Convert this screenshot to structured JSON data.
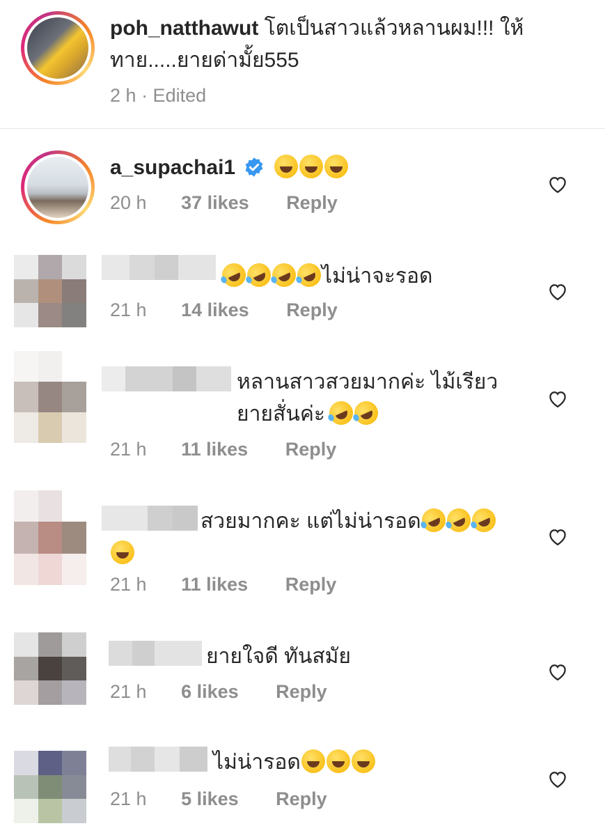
{
  "caption": {
    "username": "poh_natthawut",
    "text": " โตเป็นสาวแล้วหลานผม!!! ให้ทาย.....ยายด่ามั้ย555",
    "time": "2 h",
    "edited": "· Edited"
  },
  "comments": [
    {
      "username": "a_supachai1",
      "verified": true,
      "emoji": [
        "grinning-sweat",
        "grinning-sweat",
        "grinning-sweat"
      ],
      "text": "",
      "time": "20 h",
      "likes": "37 likes",
      "reply": "Reply"
    },
    {
      "text": "ไม่น่าจะรอด",
      "emoji": [
        "rofl",
        "rofl",
        "rofl",
        "rofl"
      ],
      "time": "21 h",
      "likes": "14 likes",
      "reply": "Reply"
    },
    {
      "text": "หลานสาวสวยมากค่ะ  ไม้เรียวยายสั่นค่ะ",
      "emoji": [
        "rofl",
        "rofl"
      ],
      "time": "21 h",
      "likes": "11 likes",
      "reply": "Reply"
    },
    {
      "text": "สวยมากคะ แต่ไม่น่ารอด",
      "emoji": [
        "rofl",
        "rofl",
        "rofl",
        "grinning-sweat"
      ],
      "time": "21 h",
      "likes": "11 likes",
      "reply": "Reply"
    },
    {
      "text": "ยายใจดี  ทันสมัย",
      "time": "21 h",
      "likes": "6 likes",
      "reply": "Reply"
    },
    {
      "text": "ไม่น่ารอด",
      "emoji": [
        "grinning",
        "grinning",
        "grinning"
      ],
      "time": "21 h",
      "likes": "5 likes",
      "reply": "Reply"
    }
  ],
  "icons": {
    "heart": "heart-outline-icon",
    "verified": "verified-badge-icon"
  },
  "colors": {
    "text": "#262626",
    "meta": "#8e8e8e",
    "verified": "#3897f0",
    "divider": "#e6e6e6"
  }
}
